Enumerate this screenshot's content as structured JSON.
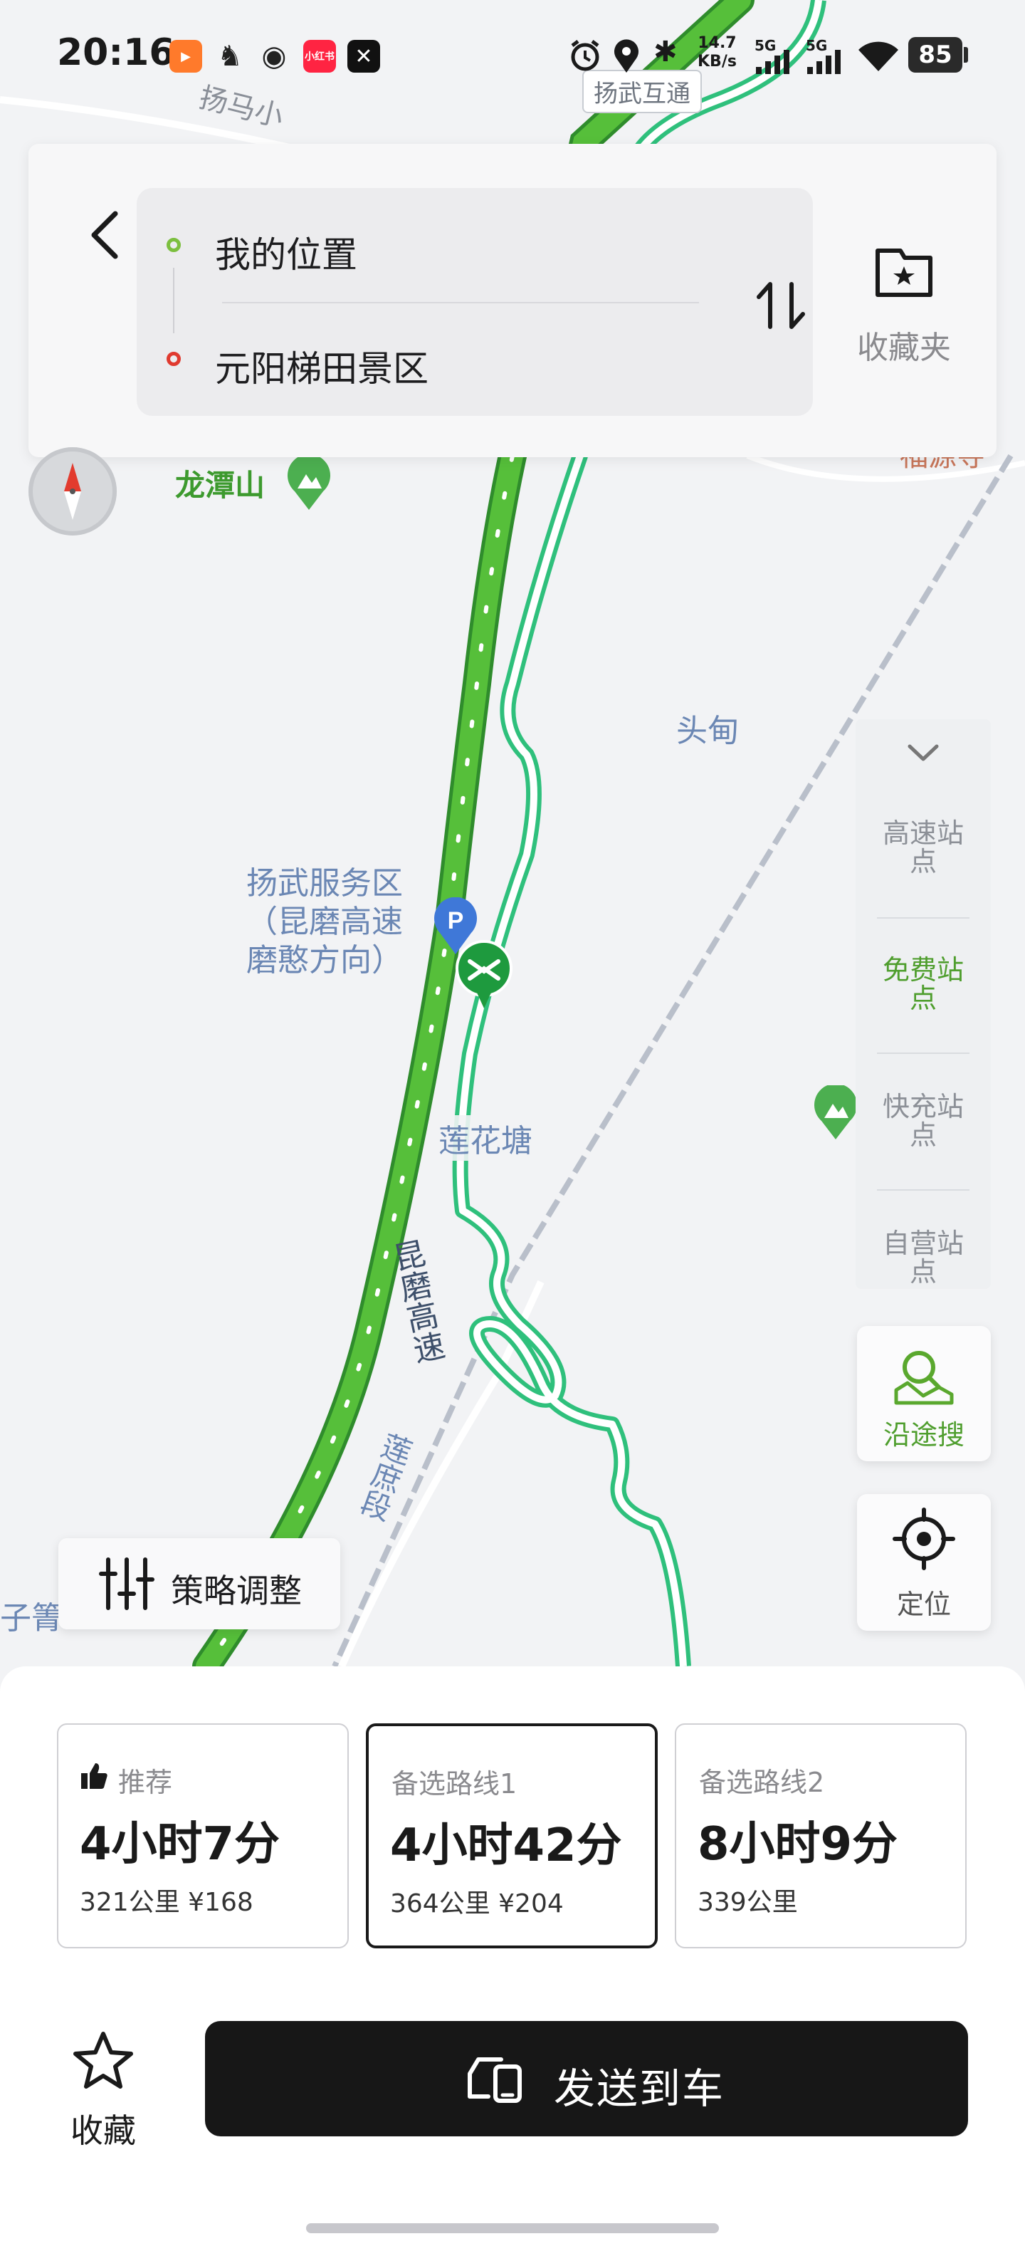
{
  "status_bar": {
    "time": "20:16",
    "network_speed_value": "14.7",
    "network_speed_unit": "KB/s",
    "signal1_label": "5G",
    "signal2_label": "5G",
    "battery": "85",
    "app_icons": [
      "bilibili-icon",
      "game-icon",
      "weibo-icon",
      "xiaohongshu-icon",
      "capcut-icon"
    ],
    "xiaohongshu_text": "小红书"
  },
  "route": {
    "origin": "我的位置",
    "destination": "元阳梯田景区",
    "favorites_folder_label": "收藏夹"
  },
  "map": {
    "labels": {
      "interchange": "扬武互通",
      "place_top": "扬马小",
      "mountain": "龙潭山",
      "temple": "福源寺",
      "village": "头甸",
      "service_area": [
        "扬武服务区",
        "（昆磨高速",
        "磨憨方向）"
      ],
      "lotus_pond": "莲花塘",
      "highway": "昆磨高速",
      "road_section": "莲庶段",
      "left_edge": "子箐"
    },
    "colors": {
      "main_route": "#3ea83a",
      "alt_route": "#2fc07c",
      "rail": "#b9bfca"
    }
  },
  "filters": {
    "items": [
      "高速站点",
      "免费站点",
      "快充站点",
      "自营站点"
    ],
    "active_index": 1
  },
  "side_buttons": {
    "search_along_route": "沿途搜",
    "locate": "定位"
  },
  "strategy_button": "策略调整",
  "route_options": [
    {
      "tag": "推荐",
      "time": "4小时7分",
      "meta": "321公里  ¥168",
      "selected": false
    },
    {
      "tag": "备选路线1",
      "time": "4小时42分",
      "meta": "364公里  ¥204",
      "selected": true
    },
    {
      "tag": "备选路线2",
      "time": "8小时9分",
      "meta": "339公里",
      "selected": false
    }
  ],
  "actions": {
    "favorite": "收藏",
    "send_to_car": "发送到车"
  }
}
